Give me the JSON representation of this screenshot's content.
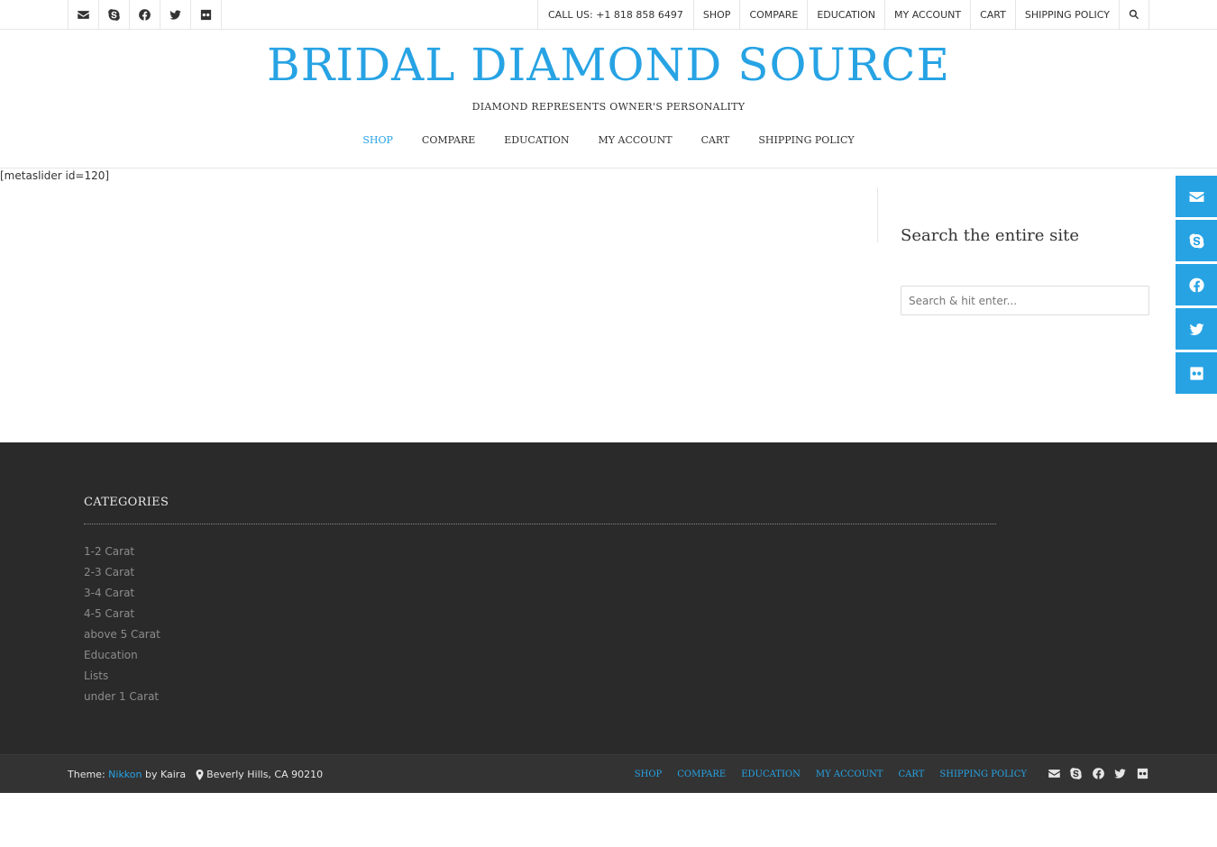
{
  "topbar": {
    "social": [
      {
        "name": "envelope-icon"
      },
      {
        "name": "skype-icon"
      },
      {
        "name": "facebook-icon"
      },
      {
        "name": "twitter-icon"
      },
      {
        "name": "flickr-icon"
      }
    ],
    "call": "CALL US: +1 818 858 6497",
    "menu": [
      "SHOP",
      "COMPARE",
      "EDUCATION",
      "MY ACCOUNT",
      "CART",
      "SHIPPING POLICY"
    ],
    "search_icon": "search-icon"
  },
  "header": {
    "title": "BRIDAL DIAMOND SOURCE",
    "tagline": "DIAMOND REPRESENTS OWNER'S PERSONALITY",
    "nav": [
      "SHOP",
      "COMPARE",
      "EDUCATION",
      "MY ACCOUNT",
      "CART",
      "SHIPPING POLICY"
    ],
    "active_nav": "SHOP"
  },
  "content": {
    "shortcode": "[metaslider id=120]"
  },
  "sidebar": {
    "widget_title": "Search the entire site",
    "search_placeholder": "Search & hit enter..."
  },
  "footer": {
    "categories_title": "CATEGORIES",
    "categories": [
      "1-2 Carat",
      "2-3 Carat",
      "3-4 Carat",
      "4-5 Carat",
      "above 5 Carat",
      "Education",
      "Lists",
      "under 1 Carat"
    ]
  },
  "bottom": {
    "theme_prefix": "Theme:",
    "theme_name": "Nikkon",
    "theme_by": "by Kaira",
    "location": "Beverly Hills, CA 90210",
    "nav": [
      "SHOP",
      "COMPARE",
      "EDUCATION",
      "MY ACCOUNT",
      "CART",
      "SHIPPING POLICY"
    ]
  },
  "colors": {
    "accent": "#27a3e4",
    "footer_bg": "#2a2a2a",
    "bottom_bg": "#333333"
  }
}
